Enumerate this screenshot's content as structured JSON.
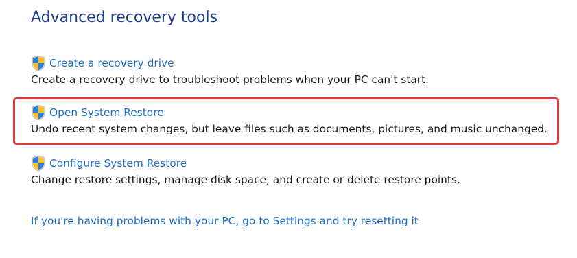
{
  "page": {
    "title": "Advanced recovery tools"
  },
  "tools": [
    {
      "link": "Create a recovery drive",
      "description": "Create a recovery drive to troubleshoot problems when your PC can't start.",
      "icon": "uac-shield-icon"
    },
    {
      "link": "Open System Restore",
      "description": "Undo recent system changes, but leave files such as documents, pictures, and music unchanged.",
      "icon": "uac-shield-icon",
      "highlighted": true
    },
    {
      "link": "Configure System Restore",
      "description": "Change restore settings, manage disk space, and create or delete restore points.",
      "icon": "uac-shield-icon"
    }
  ],
  "reset_link": "If you're having problems with your PC, go to Settings and try resetting it",
  "colors": {
    "title": "#1e3f8f",
    "link": "#1a6fc9",
    "text": "#1a1a1a",
    "highlight": "#dc3b3b"
  }
}
